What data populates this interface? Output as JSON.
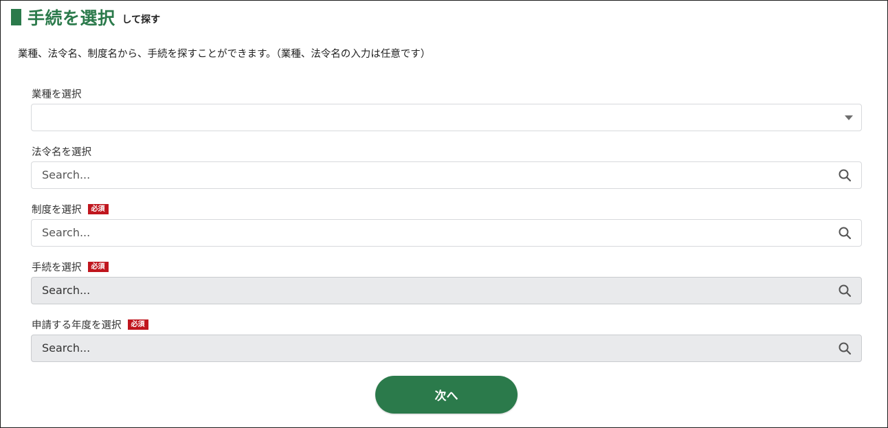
{
  "heading": {
    "title": "手続を選択",
    "subtitle": "して探す"
  },
  "intro_text": "業種、法令名、制度名から、手続を探すことができます。（業種、法令名の入力は任意です）",
  "fields": {
    "industry": {
      "label": "業種を選択",
      "value": "",
      "icon": "chevron-down-icon"
    },
    "law": {
      "label": "法令名を選択",
      "placeholder": "Search...",
      "icon": "search-icon"
    },
    "system": {
      "label": "制度を選択",
      "required": "必須",
      "placeholder": "Search...",
      "icon": "search-icon"
    },
    "procedure": {
      "label": "手続を選択",
      "required": "必須",
      "placeholder": "Search...",
      "disabled": true,
      "icon": "search-icon"
    },
    "year": {
      "label": "申請する年度を選択",
      "required": "必須",
      "placeholder": "Search...",
      "disabled": true,
      "icon": "search-icon"
    }
  },
  "next_button_label": "次へ",
  "colors": {
    "accent": "#2b7a4b",
    "required_badge": "#c0161e",
    "disabled_field": "#e9eaec",
    "border": "#d7d9dc"
  }
}
